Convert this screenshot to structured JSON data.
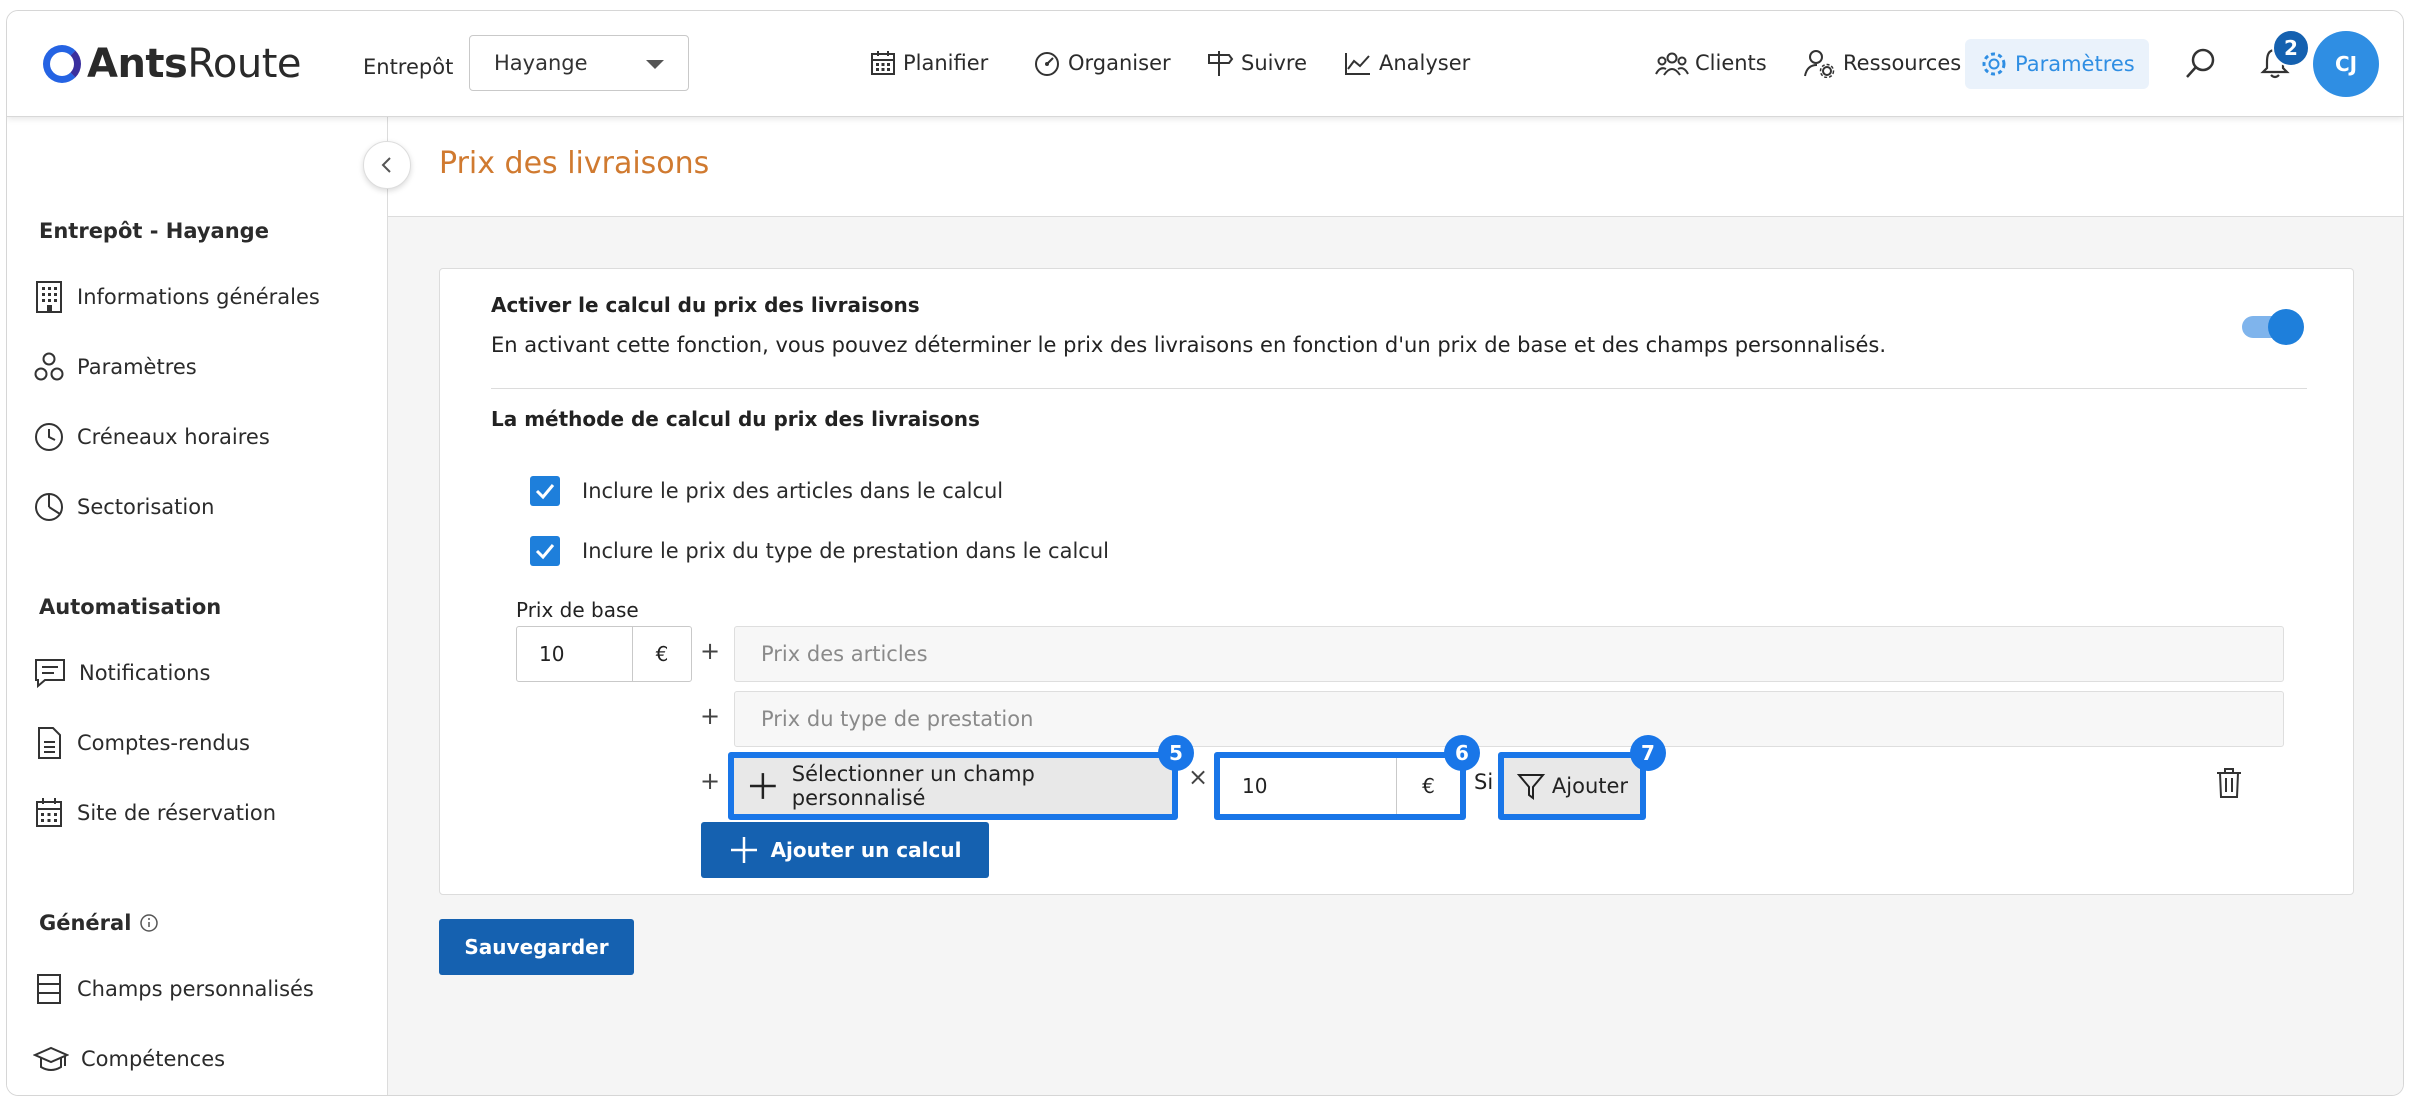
{
  "app": {
    "logo_bold": "Ants",
    "logo_regular": "Route"
  },
  "header": {
    "warehouse_label": "Entrepôt",
    "warehouse_value": "Hayange",
    "nav": {
      "plan": "Planifier",
      "organize": "Organiser",
      "track": "Suivre",
      "analyze": "Analyser",
      "clients": "Clients",
      "resources": "Ressources",
      "settings": "Paramètres"
    },
    "notification_count": "2",
    "avatar_initials": "CJ"
  },
  "sidebar": {
    "section1_title": "Entrepôt - Hayange",
    "section1_items": [
      "Informations générales",
      "Paramètres",
      "Créneaux horaires",
      "Sectorisation"
    ],
    "section2_title": "Automatisation",
    "section2_items": [
      "Notifications",
      "Comptes-rendus",
      "Site de réservation"
    ],
    "section3_title": "Général",
    "section3_items": [
      "Champs personnalisés",
      "Compétences"
    ]
  },
  "main": {
    "title": "Prix des livraisons",
    "card": {
      "title": "Activer le calcul du prix des livraisons",
      "description": "En activant cette fonction, vous pouvez déterminer le prix des livraisons en fonction d'un prix de base et des champs personnalisés.",
      "toggle_on": true,
      "method_title": "La méthode de calcul du prix des livraisons",
      "checkbox_articles": "Inclure le prix des articles dans le calcul",
      "checkbox_service": "Inclure le prix du type de prestation dans le calcul",
      "base_price_label": "Prix de base",
      "base_price_value": "10",
      "currency": "€",
      "articles_field": "Prix des articles",
      "service_field": "Prix du type de prestation",
      "custom_field_button": "Sélectionner un champ personnalisé",
      "multiplier_value": "10",
      "condition_label": "Si",
      "add_condition": "Ajouter",
      "add_calc_button": "Ajouter un calcul",
      "marker_5": "5",
      "marker_6": "6",
      "marker_7": "7"
    },
    "save_button": "Sauvegarder"
  },
  "colors": {
    "accent": "#1561b0",
    "highlight": "#1976e8",
    "title": "#d07a30",
    "active_nav": "#2f8ee3"
  }
}
